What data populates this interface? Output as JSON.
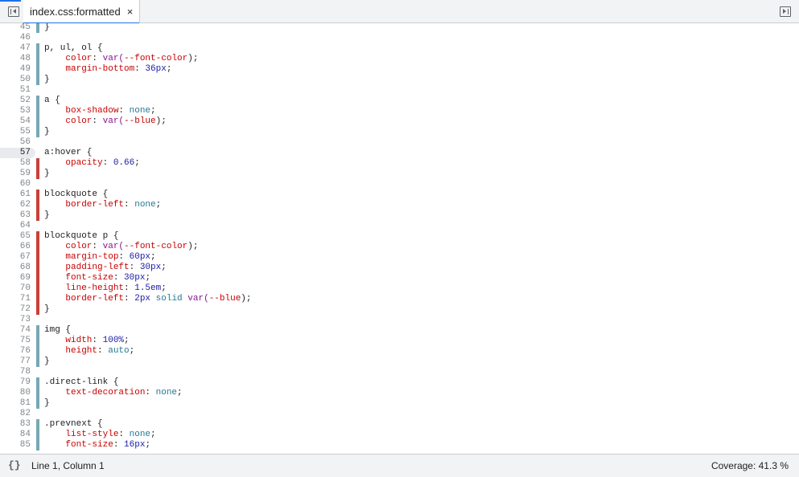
{
  "tab": {
    "label": "index.css:formatted",
    "close": "×"
  },
  "status": {
    "format_icon": "{}",
    "cursor": "Line 1, Column 1",
    "coverage": "Coverage: 41.3 %"
  },
  "colors": {
    "used": "#75a9b4",
    "unused": "#c94038",
    "accent": "#1a73e8"
  },
  "icons": {
    "left": "show-navigator-icon",
    "right": "show-debugger-icon"
  },
  "current_line": "57",
  "lines": [
    {
      "n": "45",
      "cov": "used",
      "t": [
        [
          "}",
          "punc"
        ]
      ]
    },
    {
      "n": "46",
      "cov": "",
      "t": []
    },
    {
      "n": "47",
      "cov": "used",
      "t": [
        [
          "p, ul, ol {",
          "sel"
        ]
      ]
    },
    {
      "n": "48",
      "cov": "used",
      "t": [
        [
          "    color",
          "prop"
        ],
        [
          ": ",
          "punc"
        ],
        [
          "var(",
          "fn"
        ],
        [
          "--font-color",
          "prop"
        ],
        [
          ");",
          "punc"
        ]
      ]
    },
    {
      "n": "49",
      "cov": "used",
      "t": [
        [
          "    margin-bottom",
          "prop"
        ],
        [
          ": ",
          "punc"
        ],
        [
          "36px",
          "num"
        ],
        [
          ";",
          "punc"
        ]
      ]
    },
    {
      "n": "50",
      "cov": "used",
      "t": [
        [
          "}",
          "punc"
        ]
      ]
    },
    {
      "n": "51",
      "cov": "",
      "t": []
    },
    {
      "n": "52",
      "cov": "used",
      "t": [
        [
          "a {",
          "sel"
        ]
      ]
    },
    {
      "n": "53",
      "cov": "used",
      "t": [
        [
          "    box-shadow",
          "prop"
        ],
        [
          ": ",
          "punc"
        ],
        [
          "none",
          "kw"
        ],
        [
          ";",
          "punc"
        ]
      ]
    },
    {
      "n": "54",
      "cov": "used",
      "t": [
        [
          "    color",
          "prop"
        ],
        [
          ": ",
          "punc"
        ],
        [
          "var(",
          "fn"
        ],
        [
          "--blue",
          "prop"
        ],
        [
          ");",
          "punc"
        ]
      ]
    },
    {
      "n": "55",
      "cov": "used",
      "t": [
        [
          "}",
          "punc"
        ]
      ]
    },
    {
      "n": "56",
      "cov": "",
      "t": []
    },
    {
      "n": "57",
      "cov": "",
      "t": [
        [
          "a:hover {",
          "sel"
        ]
      ]
    },
    {
      "n": "58",
      "cov": "unused",
      "t": [
        [
          "    opacity",
          "prop"
        ],
        [
          ": ",
          "punc"
        ],
        [
          "0.66",
          "num"
        ],
        [
          ";",
          "punc"
        ]
      ]
    },
    {
      "n": "59",
      "cov": "unused",
      "t": [
        [
          "}",
          "punc"
        ]
      ]
    },
    {
      "n": "60",
      "cov": "",
      "t": []
    },
    {
      "n": "61",
      "cov": "unused",
      "t": [
        [
          "blockquote {",
          "sel"
        ]
      ]
    },
    {
      "n": "62",
      "cov": "unused",
      "t": [
        [
          "    border-left",
          "prop"
        ],
        [
          ": ",
          "punc"
        ],
        [
          "none",
          "kw"
        ],
        [
          ";",
          "punc"
        ]
      ]
    },
    {
      "n": "63",
      "cov": "unused",
      "t": [
        [
          "}",
          "punc"
        ]
      ]
    },
    {
      "n": "64",
      "cov": "",
      "t": []
    },
    {
      "n": "65",
      "cov": "unused",
      "t": [
        [
          "blockquote p {",
          "sel"
        ]
      ]
    },
    {
      "n": "66",
      "cov": "unused",
      "t": [
        [
          "    color",
          "prop"
        ],
        [
          ": ",
          "punc"
        ],
        [
          "var(",
          "fn"
        ],
        [
          "--font-color",
          "prop"
        ],
        [
          ");",
          "punc"
        ]
      ]
    },
    {
      "n": "67",
      "cov": "unused",
      "t": [
        [
          "    margin-top",
          "prop"
        ],
        [
          ": ",
          "punc"
        ],
        [
          "60px",
          "num"
        ],
        [
          ";",
          "punc"
        ]
      ]
    },
    {
      "n": "68",
      "cov": "unused",
      "t": [
        [
          "    padding-left",
          "prop"
        ],
        [
          ": ",
          "punc"
        ],
        [
          "30px",
          "num"
        ],
        [
          ";",
          "punc"
        ]
      ]
    },
    {
      "n": "69",
      "cov": "unused",
      "t": [
        [
          "    font-size",
          "prop"
        ],
        [
          ": ",
          "punc"
        ],
        [
          "30px",
          "num"
        ],
        [
          ";",
          "punc"
        ]
      ]
    },
    {
      "n": "70",
      "cov": "unused",
      "t": [
        [
          "    line-height",
          "prop"
        ],
        [
          ": ",
          "punc"
        ],
        [
          "1.5em",
          "num"
        ],
        [
          ";",
          "punc"
        ]
      ]
    },
    {
      "n": "71",
      "cov": "unused",
      "t": [
        [
          "    border-left",
          "prop"
        ],
        [
          ": ",
          "punc"
        ],
        [
          "2px",
          "num"
        ],
        [
          " ",
          "punc"
        ],
        [
          "solid",
          "kw"
        ],
        [
          " ",
          "punc"
        ],
        [
          "var(",
          "fn"
        ],
        [
          "--blue",
          "prop"
        ],
        [
          ");",
          "punc"
        ]
      ]
    },
    {
      "n": "72",
      "cov": "unused",
      "t": [
        [
          "}",
          "punc"
        ]
      ]
    },
    {
      "n": "73",
      "cov": "",
      "t": []
    },
    {
      "n": "74",
      "cov": "used",
      "t": [
        [
          "img {",
          "sel"
        ]
      ]
    },
    {
      "n": "75",
      "cov": "used",
      "t": [
        [
          "    width",
          "prop"
        ],
        [
          ": ",
          "punc"
        ],
        [
          "100%",
          "num"
        ],
        [
          ";",
          "punc"
        ]
      ]
    },
    {
      "n": "76",
      "cov": "used",
      "t": [
        [
          "    height",
          "prop"
        ],
        [
          ": ",
          "punc"
        ],
        [
          "auto",
          "kw"
        ],
        [
          ";",
          "punc"
        ]
      ]
    },
    {
      "n": "77",
      "cov": "used",
      "t": [
        [
          "}",
          "punc"
        ]
      ]
    },
    {
      "n": "78",
      "cov": "",
      "t": []
    },
    {
      "n": "79",
      "cov": "used",
      "t": [
        [
          ".direct-link {",
          "sel"
        ]
      ]
    },
    {
      "n": "80",
      "cov": "used",
      "t": [
        [
          "    text-decoration",
          "prop"
        ],
        [
          ": ",
          "punc"
        ],
        [
          "none",
          "kw"
        ],
        [
          ";",
          "punc"
        ]
      ]
    },
    {
      "n": "81",
      "cov": "used",
      "t": [
        [
          "}",
          "punc"
        ]
      ]
    },
    {
      "n": "82",
      "cov": "",
      "t": []
    },
    {
      "n": "83",
      "cov": "used",
      "t": [
        [
          ".prevnext {",
          "sel"
        ]
      ]
    },
    {
      "n": "84",
      "cov": "used",
      "t": [
        [
          "    list-style",
          "prop"
        ],
        [
          ": ",
          "punc"
        ],
        [
          "none",
          "kw"
        ],
        [
          ";",
          "punc"
        ]
      ]
    },
    {
      "n": "85",
      "cov": "used",
      "t": [
        [
          "    font-size",
          "prop"
        ],
        [
          ": ",
          "punc"
        ],
        [
          "16px",
          "num"
        ],
        [
          ";",
          "punc"
        ]
      ]
    }
  ]
}
